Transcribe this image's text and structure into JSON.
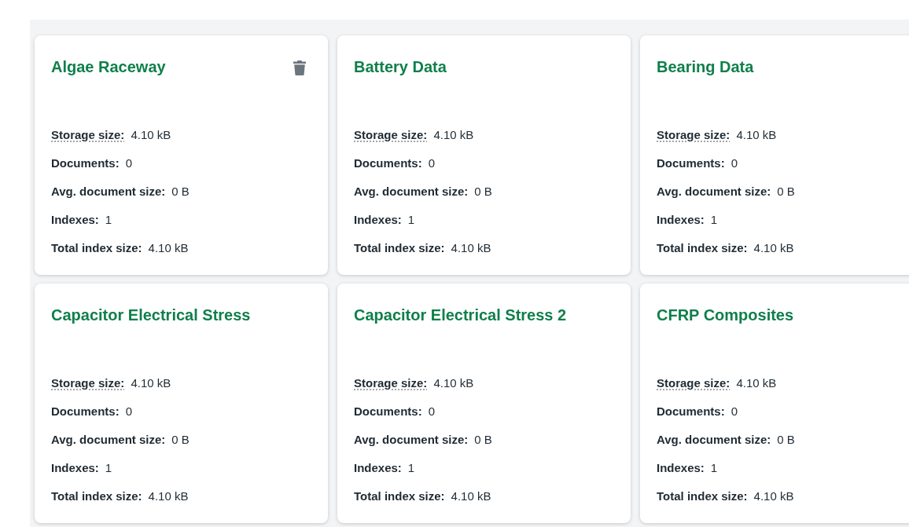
{
  "collections": [
    {
      "name": "Algae Raceway",
      "show_delete": true,
      "stats": [
        {
          "label": "Storage size:",
          "value": "4.10 kB",
          "has_tooltip": true
        },
        {
          "label": "Documents:",
          "value": "0",
          "has_tooltip": false
        },
        {
          "label": "Avg. document size:",
          "value": "0 B",
          "has_tooltip": false
        },
        {
          "label": "Indexes:",
          "value": "1",
          "has_tooltip": false
        },
        {
          "label": "Total index size:",
          "value": "4.10 kB",
          "has_tooltip": false
        }
      ]
    },
    {
      "name": "Battery Data",
      "show_delete": false,
      "stats": [
        {
          "label": "Storage size:",
          "value": "4.10 kB",
          "has_tooltip": true
        },
        {
          "label": "Documents:",
          "value": "0",
          "has_tooltip": false
        },
        {
          "label": "Avg. document size:",
          "value": "0 B",
          "has_tooltip": false
        },
        {
          "label": "Indexes:",
          "value": "1",
          "has_tooltip": false
        },
        {
          "label": "Total index size:",
          "value": "4.10 kB",
          "has_tooltip": false
        }
      ]
    },
    {
      "name": "Bearing Data",
      "show_delete": false,
      "stats": [
        {
          "label": "Storage size:",
          "value": "4.10 kB",
          "has_tooltip": true
        },
        {
          "label": "Documents:",
          "value": "0",
          "has_tooltip": false
        },
        {
          "label": "Avg. document size:",
          "value": "0 B",
          "has_tooltip": false
        },
        {
          "label": "Indexes:",
          "value": "1",
          "has_tooltip": false
        },
        {
          "label": "Total index size:",
          "value": "4.10 kB",
          "has_tooltip": false
        }
      ]
    },
    {
      "name": "Capacitor Electrical Stress",
      "show_delete": false,
      "stats": [
        {
          "label": "Storage size:",
          "value": "4.10 kB",
          "has_tooltip": true
        },
        {
          "label": "Documents:",
          "value": "0",
          "has_tooltip": false
        },
        {
          "label": "Avg. document size:",
          "value": "0 B",
          "has_tooltip": false
        },
        {
          "label": "Indexes:",
          "value": "1",
          "has_tooltip": false
        },
        {
          "label": "Total index size:",
          "value": "4.10 kB",
          "has_tooltip": false
        }
      ]
    },
    {
      "name": "Capacitor Electrical Stress 2",
      "show_delete": false,
      "stats": [
        {
          "label": "Storage size:",
          "value": "4.10 kB",
          "has_tooltip": true
        },
        {
          "label": "Documents:",
          "value": "0",
          "has_tooltip": false
        },
        {
          "label": "Avg. document size:",
          "value": "0 B",
          "has_tooltip": false
        },
        {
          "label": "Indexes:",
          "value": "1",
          "has_tooltip": false
        },
        {
          "label": "Total index size:",
          "value": "4.10 kB",
          "has_tooltip": false
        }
      ]
    },
    {
      "name": "CFRP Composites",
      "show_delete": false,
      "stats": [
        {
          "label": "Storage size:",
          "value": "4.10 kB",
          "has_tooltip": true
        },
        {
          "label": "Documents:",
          "value": "0",
          "has_tooltip": false
        },
        {
          "label": "Avg. document size:",
          "value": "0 B",
          "has_tooltip": false
        },
        {
          "label": "Indexes:",
          "value": "1",
          "has_tooltip": false
        },
        {
          "label": "Total index size:",
          "value": "4.10 kB",
          "has_tooltip": false
        }
      ]
    }
  ]
}
